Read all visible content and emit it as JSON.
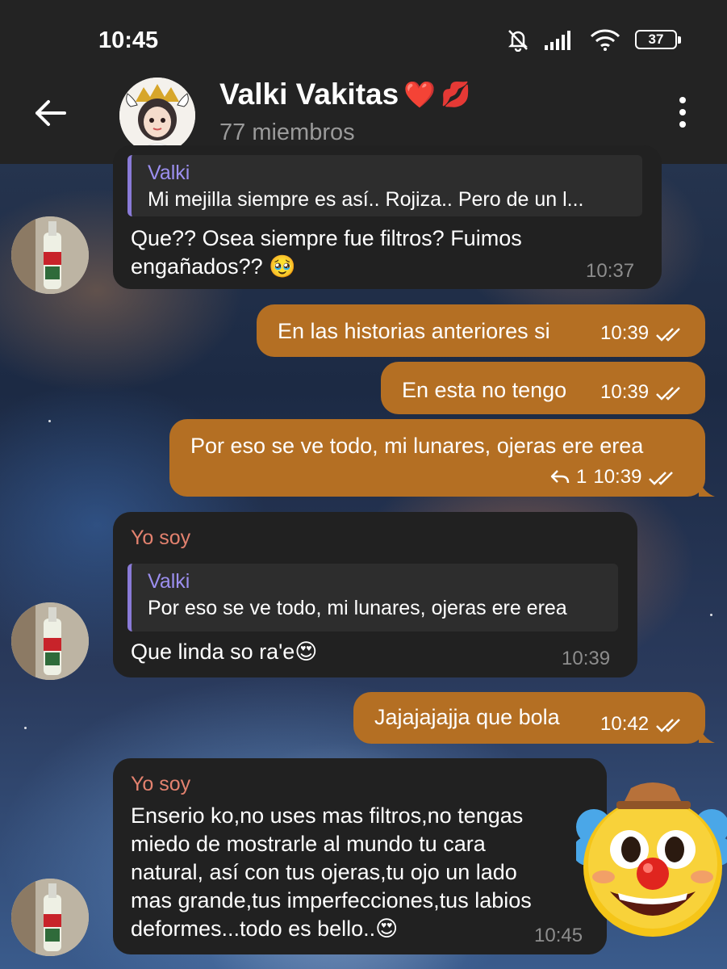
{
  "status_bar": {
    "time": "10:45",
    "battery": "37"
  },
  "header": {
    "title": "Valki Vakitas",
    "title_emojis": [
      "❤️",
      "💋"
    ],
    "subtitle": "77 miembros"
  },
  "messages": [
    {
      "kind": "incoming",
      "quote_name": "Valki",
      "quote_text": "Mi mejilla siempre es así.. Rojiza..  Pero de un l...",
      "text_line1": "Que?? Osea siempre fue filtros? Fuimos",
      "text_line2": "engañados?? 🥹",
      "time": "10:37"
    },
    {
      "kind": "outgoing",
      "text": "En las historias anteriores si",
      "time": "10:39"
    },
    {
      "kind": "outgoing",
      "text": "En esta no tengo",
      "time": "10:39"
    },
    {
      "kind": "outgoing",
      "text": "Por eso se ve todo, mi lunares, ojeras ere erea",
      "replies": "1",
      "time": "10:39"
    },
    {
      "kind": "incoming",
      "sender": "Yo soy",
      "quote_name": "Valki",
      "quote_text": "Por eso se ve todo, mi lunares, ojeras ere erea",
      "text": "Que linda so ra'e😍",
      "time": "10:39"
    },
    {
      "kind": "outgoing",
      "text": "Jajajajajja que bola",
      "time": "10:42"
    },
    {
      "kind": "incoming",
      "sender": "Yo soy",
      "lines": [
        "Enserio ko,no uses mas filtros,no tengas",
        "miedo de mostrarle al mundo tu cara",
        "natural, así con tus ojeras,tu ojo un lado",
        "mas grande,tus imperfecciones,tus labios",
        "deformes...todo es bello..😍"
      ],
      "time": "10:45",
      "sticker": "clown-face-emoji"
    }
  ],
  "icons": {
    "back": "arrow-left-icon",
    "menu": "vertical-dots-icon",
    "read": "double-check-icon",
    "reply": "reply-arrow-icon",
    "mute": "bell-off-icon",
    "signal": "signal-icon",
    "wifi": "wifi-icon"
  },
  "colors": {
    "outgoing_bubble": "#b46f23",
    "incoming_bubble": "#212121",
    "sender_name": "#e4826f",
    "quote_accent": "#8a7bd8",
    "header_bg": "#232323"
  }
}
